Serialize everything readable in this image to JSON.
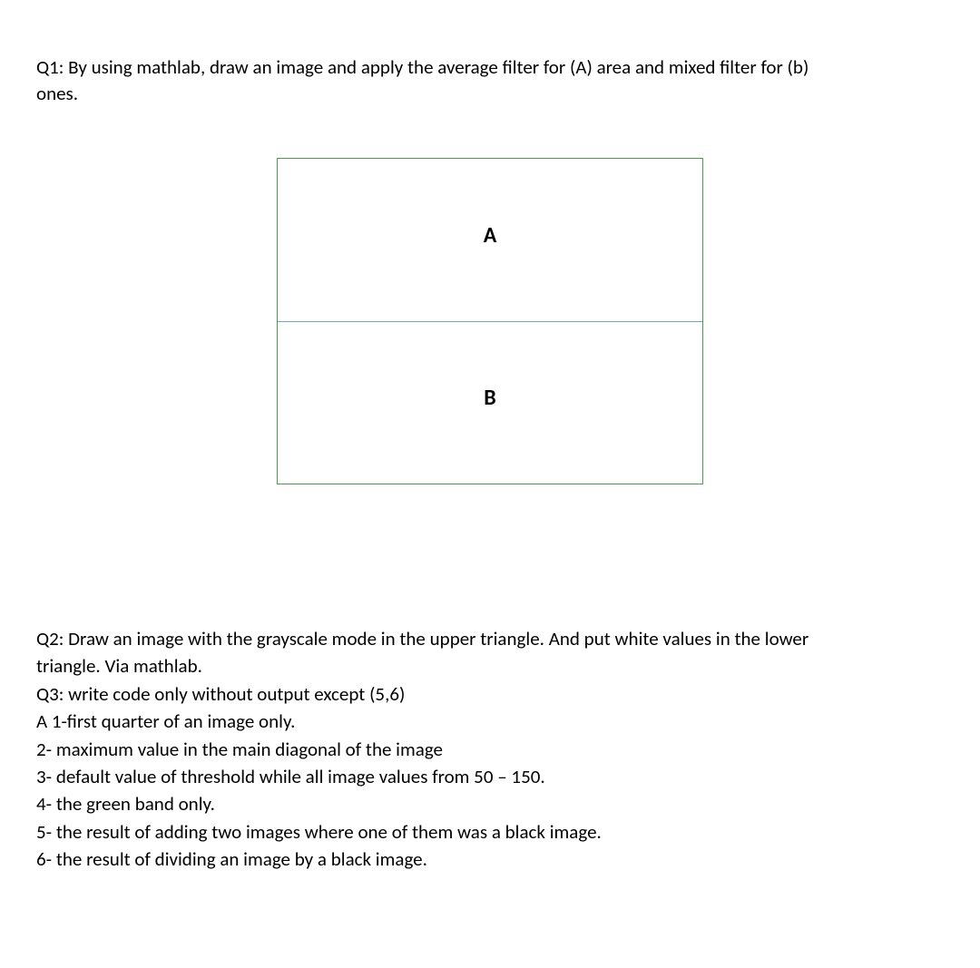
{
  "q1": {
    "line1": "Q1: By using mathlab, draw an image and apply the average filter for (A) area and mixed filter for (b)",
    "line2": "ones."
  },
  "diagram": {
    "labelA": "A",
    "labelB": "B"
  },
  "q2": {
    "line1": "Q2: Draw an image with the grayscale mode in the upper triangle. And put white values in the lower",
    "line2": "triangle. Via mathlab."
  },
  "q3": {
    "header": "Q3: write code only without output except (5,6)",
    "items": {
      "i1": "A 1-first quarter of an image only.",
      "i2": "2- maximum value in the main diagonal of the image",
      "i3": "3- default value of threshold while all image values from 50 – 150.",
      "i4": "4- the green band only.",
      "i5": "5- the result of adding two images where one of them was a black image.",
      "i6": "6- the result of dividing an image by a black image."
    }
  }
}
